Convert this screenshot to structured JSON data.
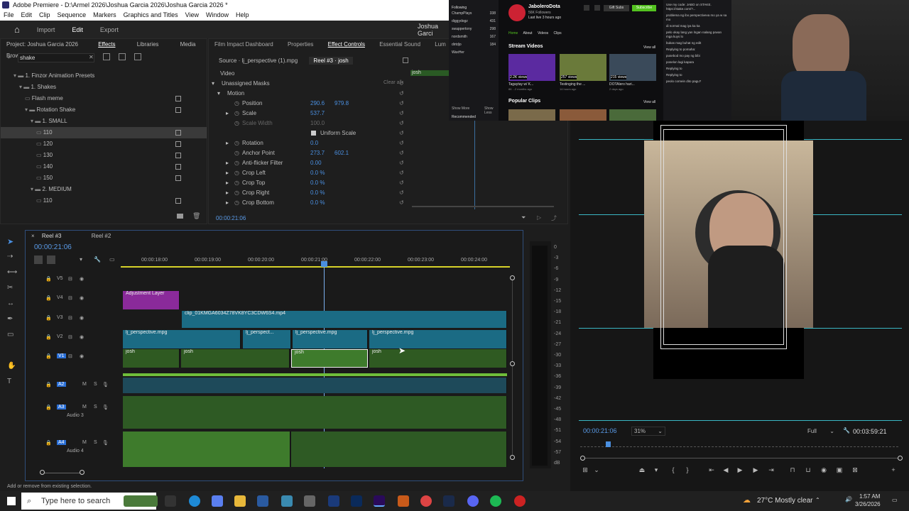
{
  "app": {
    "title": "Adobe Premiere - D:\\Armel 2026\\Joshua Garcia 2026\\Joshua Garcia 2026 *"
  },
  "menu": [
    "File",
    "Edit",
    "Clip",
    "Sequence",
    "Markers",
    "Graphics and Titles",
    "View",
    "Window",
    "Help"
  ],
  "workspace": {
    "home": "⌂",
    "tabs": [
      "Import",
      "Edit",
      "Export"
    ],
    "project_name": "Joshua Garci"
  },
  "left_panel": {
    "project": "Project: Joshua Garcia 2026",
    "tab_effects": "Effects",
    "tab_libraries": "Libraries",
    "tab_media": "Media Browse",
    "search_value": "shake",
    "tree": [
      {
        "label": "1. Finzor Animation Presets",
        "indent": 1,
        "folder": true
      },
      {
        "label": "1. Shakes",
        "indent": 2,
        "folder": true
      },
      {
        "label": "Flash meme",
        "indent": 3,
        "folder": false
      },
      {
        "label": "Rotation Shake",
        "indent": 3,
        "folder": true
      },
      {
        "label": "1. SMALL",
        "indent": 4,
        "folder": true
      },
      {
        "label": "110",
        "indent": 5,
        "folder": false,
        "selected": true
      },
      {
        "label": "120",
        "indent": 5,
        "folder": false
      },
      {
        "label": "130",
        "indent": 5,
        "folder": false
      },
      {
        "label": "140",
        "indent": 5,
        "folder": false
      },
      {
        "label": "150",
        "indent": 5,
        "folder": false
      },
      {
        "label": "2. MEDIUM",
        "indent": 4,
        "folder": true
      },
      {
        "label": "110",
        "indent": 5,
        "folder": false
      }
    ]
  },
  "effect_controls": {
    "tabs": [
      "Film Impact Dashboard",
      "Properties",
      "Effect Controls",
      "Essential Sound",
      "Lum"
    ],
    "source_tab": "Source · lj_perspective (1).mpg",
    "reel_tab": "Reel #3 · josh",
    "section": "Video",
    "clip_label": "josh",
    "clear_all": "Clear all",
    "rows": [
      {
        "name": "Unassigned Masks",
        "v1": "",
        "v2": "",
        "level": 0
      },
      {
        "name": "Motion",
        "v1": "",
        "v2": "",
        "level": 0,
        "fx": true
      },
      {
        "name": "Position",
        "v1": "290.6",
        "v2": "979.8",
        "level": 1
      },
      {
        "name": "Scale",
        "v1": "537.7",
        "v2": "",
        "level": 1,
        "expand": true
      },
      {
        "name": "Scale Width",
        "v1": "100.0",
        "v2": "",
        "level": 1,
        "dim": true
      },
      {
        "name": "",
        "v1": "",
        "v2": "",
        "level": 1,
        "checkbox": "Uniform Scale"
      },
      {
        "name": "Rotation",
        "v1": "0.0",
        "v2": "",
        "level": 1,
        "expand": true
      },
      {
        "name": "Anchor Point",
        "v1": "273.7",
        "v2": "602.1",
        "level": 1
      },
      {
        "name": "Anti-flicker Filter",
        "v1": "0.00",
        "v2": "",
        "level": 1,
        "expand": true
      },
      {
        "name": "Crop Left",
        "v1": "0.0 %",
        "v2": "",
        "level": 1,
        "expand": true
      },
      {
        "name": "Crop Top",
        "v1": "0.0 %",
        "v2": "",
        "level": 1,
        "expand": true
      },
      {
        "name": "Crop Right",
        "v1": "0.0 %",
        "v2": "",
        "level": 1,
        "expand": true
      },
      {
        "name": "Crop Bottom",
        "v1": "0.0 %",
        "v2": "",
        "level": 1,
        "expand": true
      }
    ],
    "timecode": "00:00:21:06"
  },
  "timeline": {
    "tabs": [
      "Reel #3",
      "Reel #2"
    ],
    "timecode": "00:00:21:06",
    "ruler": [
      "00:00:18:00",
      "00:00:19:00",
      "00:00:20:00",
      "00:00:21:00",
      "00:00:22:00",
      "00:00:23:00",
      "00:00:24:00"
    ],
    "tracks": [
      {
        "name": "V5"
      },
      {
        "name": "V4"
      },
      {
        "name": "V3"
      },
      {
        "name": "V2"
      },
      {
        "name": "V1"
      },
      {
        "name": "A2"
      },
      {
        "name": "A3",
        "label": "Audio 3"
      },
      {
        "name": "A4",
        "label": "Audio 4"
      }
    ],
    "clips": {
      "adjustment": "Adjustment Layer",
      "v3": "clip_01KMGA6034Z78VK8YC3CDW6S4.mp4",
      "v2": [
        "lj_perspective.mpg",
        "lj_perspect...",
        "lj_perspective.mpg",
        "lj_perspective.mpg"
      ],
      "v1": [
        "josh",
        "josh",
        "josh",
        "josh"
      ]
    },
    "meter": [
      "0",
      "-3",
      "-6",
      "-9",
      "-12",
      "-15",
      "-18",
      "-21",
      "-24",
      "-27",
      "-30",
      "-33",
      "-36",
      "-39",
      "-42",
      "-45",
      "-48",
      "-51",
      "-54",
      "-57",
      "dB"
    ],
    "status": "Add or remove from existing selection."
  },
  "program": {
    "timecode": "00:00:21:06",
    "zoom": "31%",
    "quality": "Full",
    "duration": "00:03:59:21"
  },
  "stream": {
    "channel": "JaboleroDota",
    "followers": "56K Followers",
    "last_live": "Last live 3 hours ago",
    "nav": [
      "Home",
      "About",
      "Videos",
      "Clips"
    ],
    "following": "Following",
    "streams_title": "Stream Videos",
    "view_all": "View all",
    "clips_title": "Popular Clips",
    "recommended": "Recommended",
    "show_more": "Show More",
    "show_less": "Show Less",
    "gift": "Gift Subs",
    "subscribe": "Subscribe",
    "sidebar": [
      {
        "name": "ChampPlays",
        "count": "338"
      },
      {
        "name": "diggydogz",
        "count": "431"
      },
      {
        "name": "swappertony",
        "count": "298"
      },
      {
        "name": "nordsmith",
        "count": "167"
      },
      {
        "name": "dirtdjo",
        "count": "184"
      },
      {
        "name": "WaxHer",
        "count": ""
      }
    ],
    "videos": [
      {
        "views": "2.2K views",
        "title": "Tagaytay w/ K...",
        "ago": "86 ...2 months ago"
      },
      {
        "views": "257 views",
        "title": "Testinging the ...",
        "ago": "14 hours ago"
      },
      {
        "views": "215 views",
        "title": "DOTAlero hari...",
        "ago": "2 days ago"
      }
    ],
    "chat": [
      "Use my code: JABO on STAKE. https://stake.com/?...",
      "problema ng ibo perspectiveva mo ya w sa mo",
      "di normal mag iya ka ka",
      "pelo okay lang yan lngan nalang pavan mga kuys lo",
      "bukas mag buhat ng edit",
      "Replying to pomaha:",
      "pusebod mo pay ng bibi",
      "poselon lagi kapara",
      "Replying to",
      "Replying to",
      "peolo cornein dito pagu?"
    ]
  },
  "taskbar": {
    "search": "Type here to search",
    "weather": "27°C  Mostly clear",
    "time": "1:57 AM",
    "date": "3/26/2026"
  }
}
